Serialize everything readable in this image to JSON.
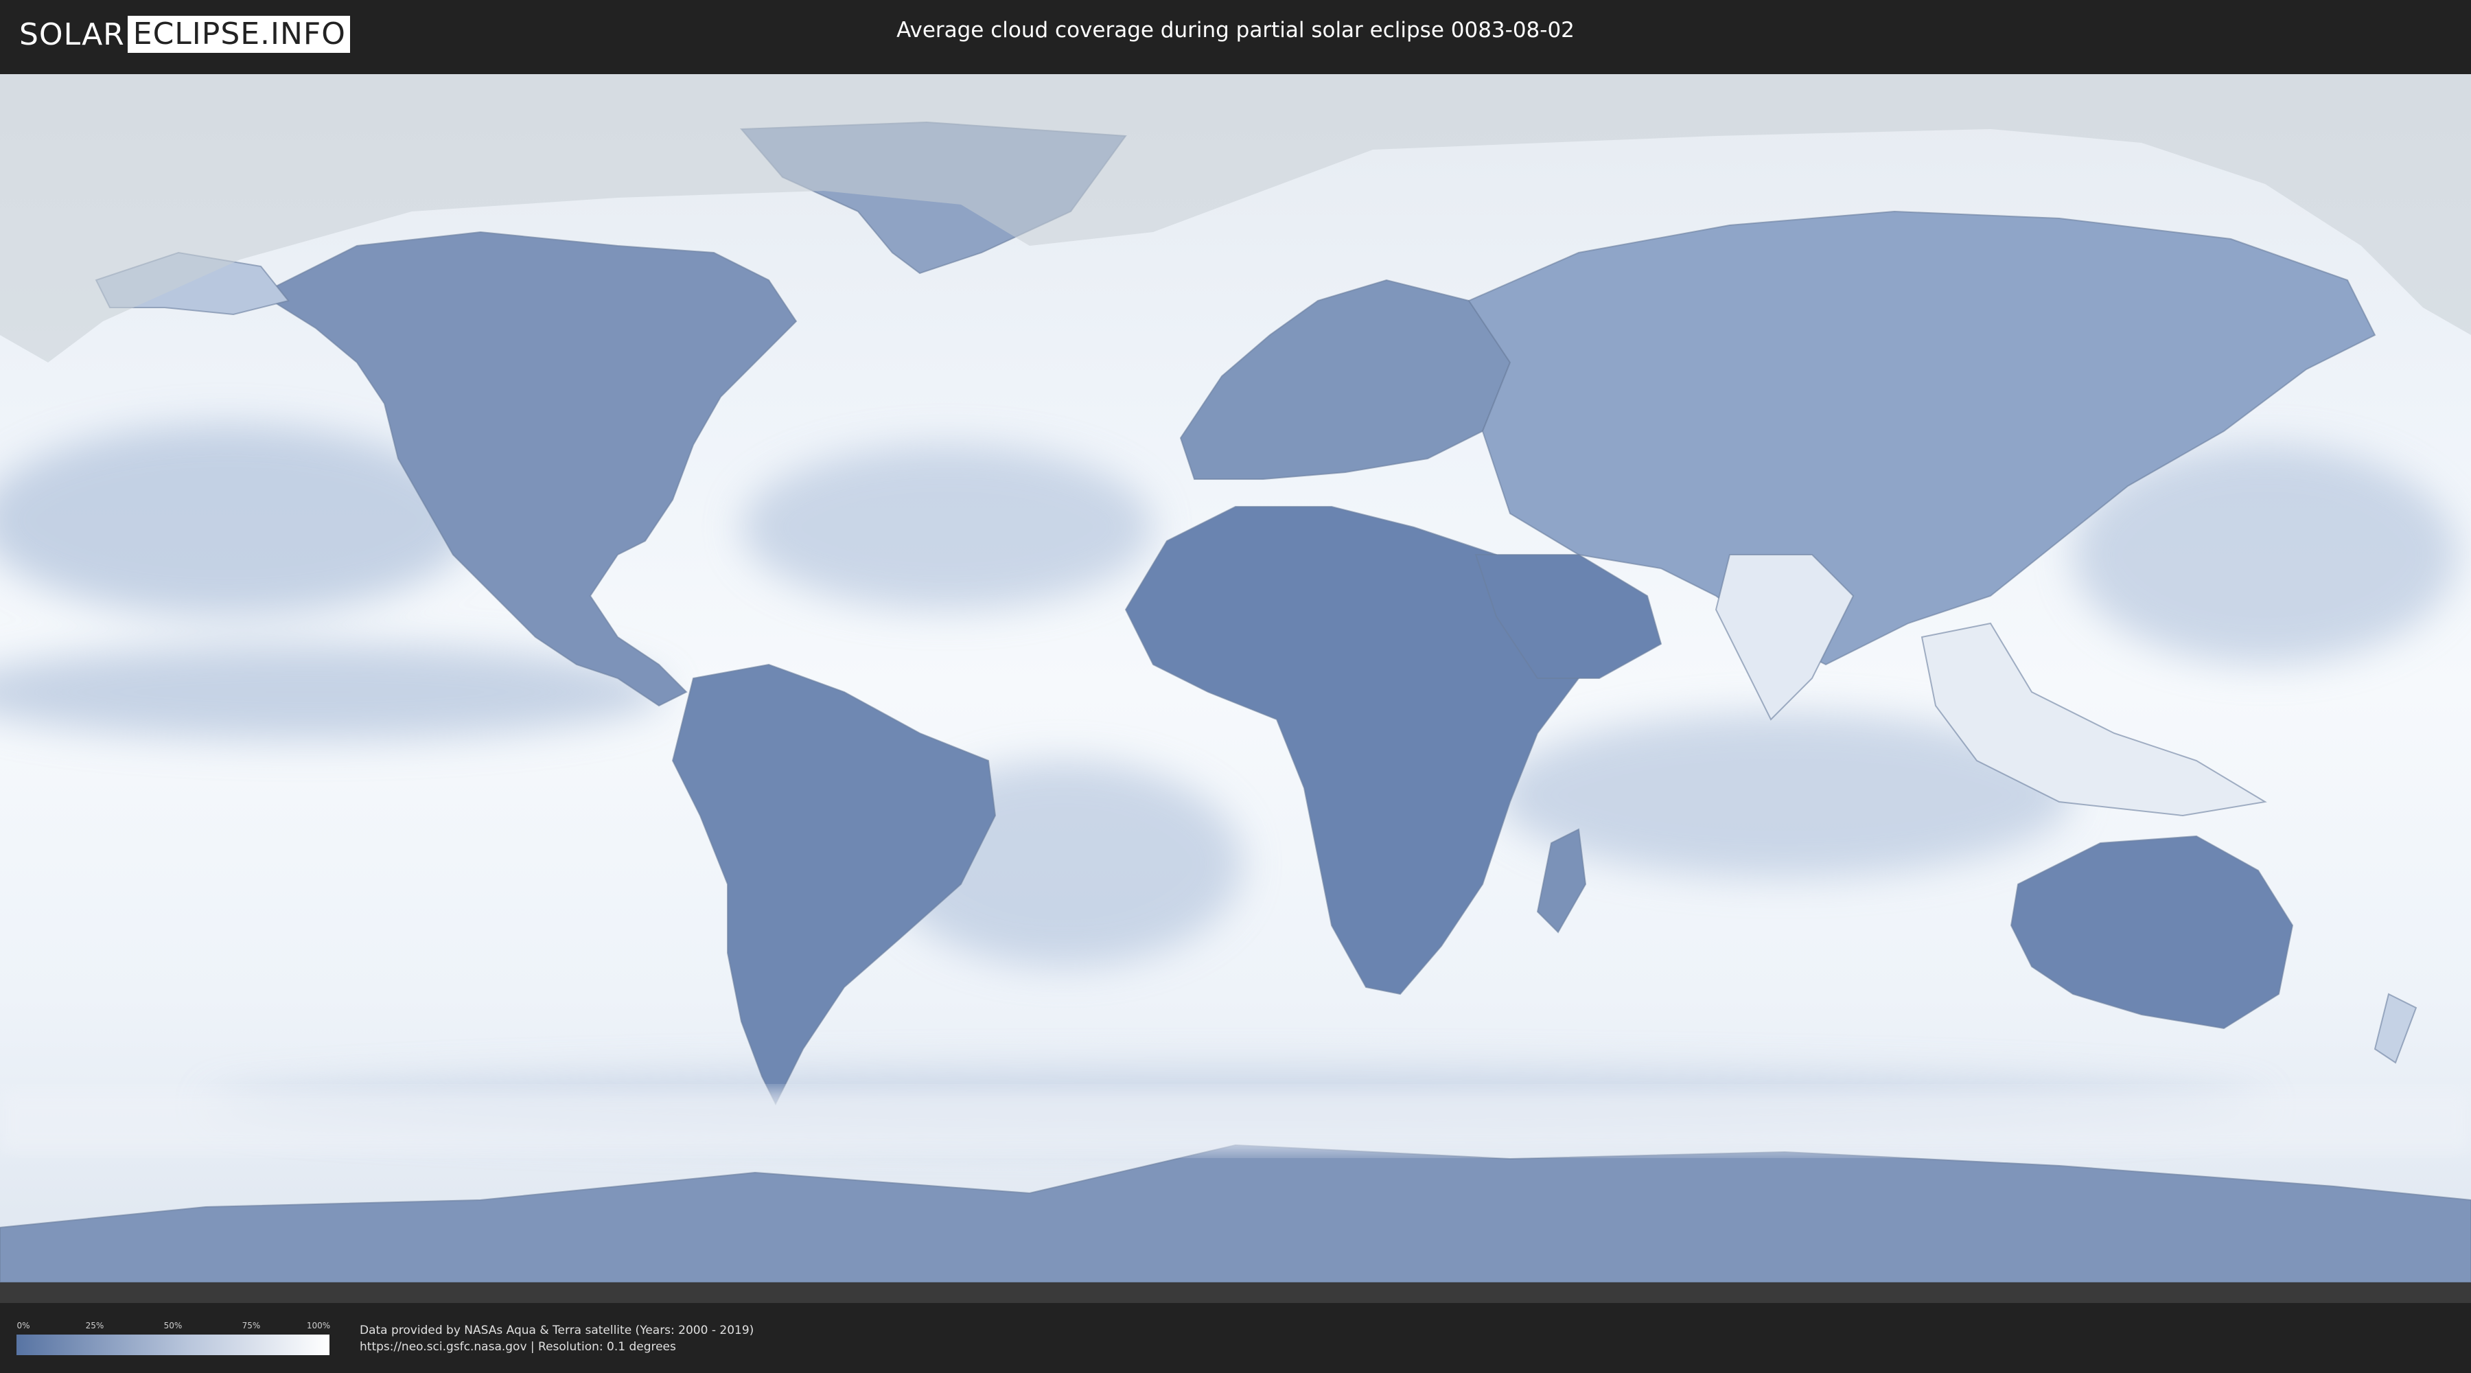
{
  "header": {
    "logo": {
      "solar": "SOLAR",
      "eclipse": "ECLIPSE.INFO"
    },
    "title": "Average cloud coverage during partial solar eclipse 0083-08-02"
  },
  "map": {
    "ocean_color": "#f4f7fb",
    "clear_color": "#5874a3",
    "shadow_overlay_color": "#c9cfd6"
  },
  "legend": {
    "ticks": [
      "0%",
      "25%",
      "50%",
      "75%",
      "100%"
    ],
    "gradient_colors": [
      "#5874a3",
      "#b9c6dc",
      "#ffffff"
    ]
  },
  "credits": {
    "line1": "Data provided by NASAs Aqua & Terra satellite (Years: 2000 - 2019)",
    "line2": "https://neo.sci.gsfc.nasa.gov | Resolution: 0.1 degrees"
  }
}
